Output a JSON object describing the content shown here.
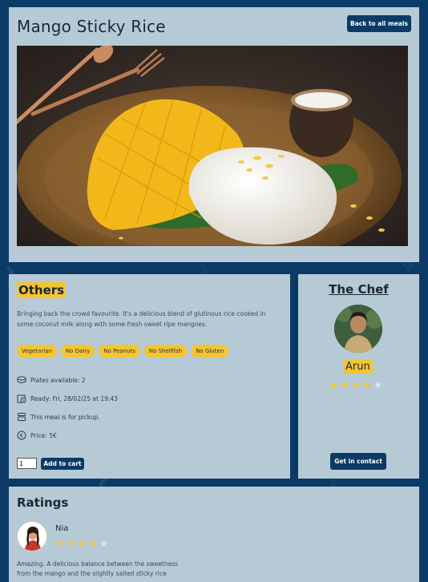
{
  "meal": {
    "title": "Mango Sticky Rice",
    "back_label": "Back to all meals",
    "image_alt": "Mango sticky rice on a plate"
  },
  "details": {
    "heading": "Others",
    "description": "Bringing back the crowd favourite. It's a delicious blend of glutinous rice cooked in some coconut milk along with some fresh sweet ripe mangoes.",
    "tags": [
      "Vegetarian",
      "No Dairy",
      "No Peanuts",
      "No Shellfish",
      "No Gluten"
    ],
    "plates": "Plates available: 2",
    "ready": "Ready: Fri, 28/02/25 at 19:43",
    "pickup": "This meal is for pickup.",
    "price": "Price: 5€",
    "quantity": "1",
    "add_to_cart_label": "Add to cart",
    "icons": [
      "plates-icon",
      "calendar-clock-icon",
      "pickup-icon",
      "euro-icon"
    ]
  },
  "chef": {
    "heading": "The Chef",
    "name": "Arun",
    "rating": 4,
    "rating_max": 5,
    "contact_label": "Get in contact"
  },
  "ratings": {
    "heading": "Ratings",
    "items": [
      {
        "name": "Nia",
        "rating": 4,
        "rating_max": 5,
        "text": "Amazing. A delicious balance between the sweetness from the mango and the slightly salted sticky rice"
      }
    ]
  },
  "colors": {
    "background": "#0b3a66",
    "card": "#b6cad6",
    "accent": "#f4c531",
    "button": "#0b3a66"
  }
}
